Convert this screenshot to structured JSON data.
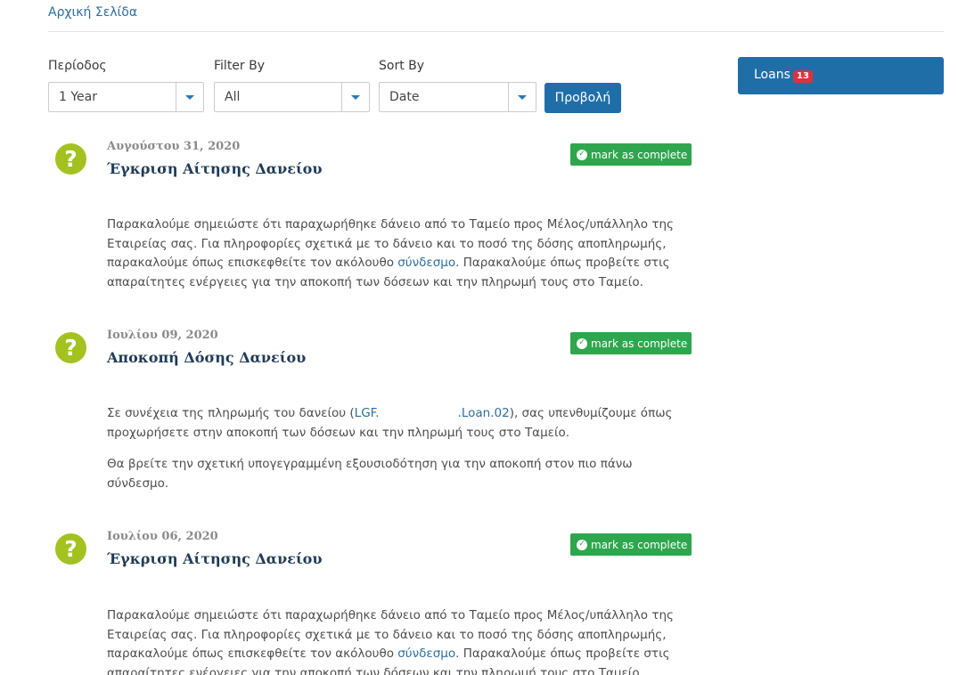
{
  "breadcrumb": {
    "home": "Αρχική Σελίδα"
  },
  "filters": {
    "period": {
      "label": "Περίοδος",
      "value": "1 Year"
    },
    "filter_by": {
      "label": "Filter By",
      "value": "All"
    },
    "sort_by": {
      "label": "Sort By",
      "value": "Date"
    },
    "view_button": "Προβολή"
  },
  "sidebar": {
    "loans": {
      "label": "Loans",
      "badge": "13"
    }
  },
  "items": [
    {
      "date": "Αυγούστου 31, 2020",
      "title": "Έγκριση Αίτησης Δανείου",
      "complete_label": "mark as complete",
      "text_before_link": "Παρακαλούμε σημειώστε ότι παραχωρήθηκε δάνειο από το Ταμείο προς Μέλος/υπάλληλο της Εταιρείας σας. Για πληροφορίες σχετικά με το δάνειο και το ποσό της δόσης αποπληρωμής, παρακαλούμε όπως επισκεφθείτε τον ακόλουθο ",
      "link": "σύνδεσμο",
      "text_after_link": ". Παρακαλούμε όπως προβείτε στις απαραίτητες ενέργειες για την αποκοπή των δόσεων και την πληρωμή τους στο Ταμείο."
    },
    {
      "date": "Ιουλίου 09, 2020",
      "title": "Αποκοπή Δόσης Δανείου",
      "complete_label": "mark as complete",
      "text_before_link": "Σε συνέχεια της πληρωμής του δανείου (",
      "link_part1": "LGF.",
      "link_part2": ".Loan.02",
      "text_after_link": "), σας υπενθυμίζουμε όπως προχωρήσετε στην αποκοπή των δόσεων και την πληρωμή τους στο Ταμείο.",
      "text_second": "Θα βρείτε την σχετική υπογεγραμμένη εξουσιοδότηση για την αποκοπή στον πιο πάνω σύνδεσμο."
    },
    {
      "date": "Ιουλίου 06, 2020",
      "title": "Έγκριση Αίτησης Δανείου",
      "complete_label": "mark as complete",
      "text_before_link": "Παρακαλούμε σημειώστε ότι παραχωρήθηκε δάνειο από το Ταμείο προς Μέλος/υπάλληλο της Εταιρείας σας. Για πληροφορίες σχετικά με το δάνειο και το ποσό της δόσης αποπληρωμής, παρακαλούμε όπως επισκεφθείτε τον ακόλουθο ",
      "link": "σύνδεσμο",
      "text_after_link": ". Παρακαλούμε όπως προβείτε στις απαραίτητες ενέργειες για την αποκοπή των δόσεων και την πληρωμή τους στο Ταμείο."
    }
  ],
  "icons": {
    "question": "?",
    "check": "✓"
  },
  "colors": {
    "link": "#2c6e9e",
    "primary": "#1f6ea8",
    "success": "#2ea64d",
    "question_icon": "#a3c21f",
    "badge": "#d9343a"
  }
}
